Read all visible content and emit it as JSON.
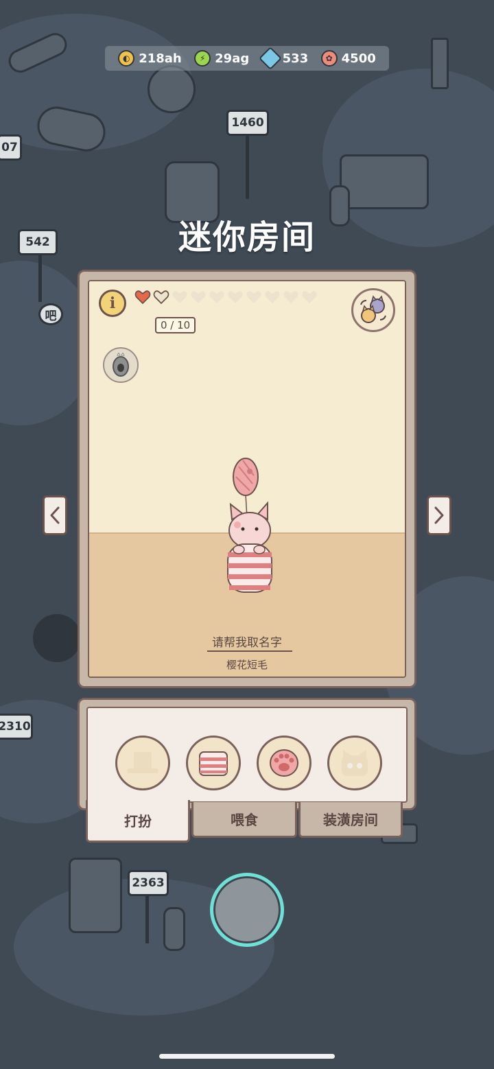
{
  "currency": [
    {
      "icon": "coin-icon",
      "value": "218ah",
      "color": "#f2c14a"
    },
    {
      "icon": "lightning-icon",
      "value": "29ag",
      "color": "#9bd64c"
    },
    {
      "icon": "gem-icon",
      "value": "533",
      "color": "#7ac8e6"
    },
    {
      "icon": "shell-icon",
      "value": "4500",
      "color": "#f08a7a"
    }
  ],
  "background_signs": [
    "1460",
    "542",
    "2310",
    "2363",
    "07",
    "吧"
  ],
  "title": "迷你房间",
  "room": {
    "info_label": "i",
    "affection_text": "0 / 10",
    "hearts_filled": 1,
    "hearts_total": 10,
    "name_prompt": "请帮我取名字",
    "breed": "樱花短毛"
  },
  "wardrobe": {
    "slots": [
      "hat-slot-icon",
      "shirt-slot-icon",
      "paw-slot-icon",
      "cat-face-slot-icon"
    ]
  },
  "tabs": [
    {
      "label": "打扮",
      "active": true
    },
    {
      "label": "喂食",
      "active": false
    },
    {
      "label": "装潢房间",
      "active": false
    }
  ],
  "colors": {
    "accent_cyan": "#6fe0d6",
    "frame_brown": "#7a625b",
    "wall": "#f5ecd2",
    "floor": "#e6c8a0",
    "heart_red": "#e8694a"
  }
}
